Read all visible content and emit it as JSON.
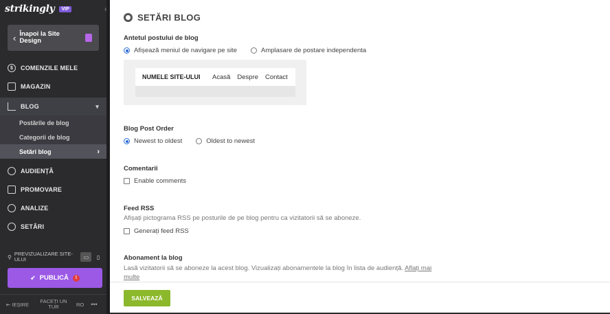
{
  "sidebar": {
    "logo": "strikingly",
    "vip_badge": "VIP",
    "back_button": "Înapoi la Site Design",
    "nav": {
      "orders": "COMENZILE MELE",
      "store": "MAGAZIN",
      "blog": "BLOG",
      "audience": "AUDIENȚĂ",
      "promotion": "PROMOVARE",
      "analytics": "ANALIZE",
      "settings": "SETĂRI"
    },
    "blog_sub": {
      "posts": "Postările de blog",
      "categories": "Categorii de blog",
      "settings": "Setări blog"
    },
    "preview_label": "PREVIZUALIZARE SITE-ULUI",
    "publish": "PUBLICĂ",
    "publish_alert": "!",
    "footer": {
      "exit": "IEȘIRE",
      "tour": "FACEȚI UN TUR",
      "lang": "RO",
      "more": "•••"
    }
  },
  "main": {
    "title": "SETĂRI BLOG",
    "header_section": {
      "label": "Antetul postului de blog",
      "option_nav": "Afișează meniul de navigare pe site",
      "option_standalone": "Amplasare de postare independenta"
    },
    "preview": {
      "site_name": "NUMELE SITE-ULUI",
      "links": [
        "Acasă",
        "Despre",
        "Contact"
      ]
    },
    "order_section": {
      "label": "Blog Post Order",
      "newest": "Newest to oldest",
      "oldest": "Oldest to newest"
    },
    "comments_section": {
      "label": "Comentarii",
      "enable": "Enable comments"
    },
    "rss_section": {
      "label": "Feed RSS",
      "description": "Afișați pictograma RSS pe posturile de pe blog pentru ca vizitatorii să se aboneze.",
      "generate": "Generați feed RSS"
    },
    "subscription_section": {
      "label": "Abonament la blog",
      "description": "Lasă vizitatorii să se aboneze la acest blog. Vizualizați abonamentele la blog în lista de audiență.",
      "learn_more": "Aflați mai multe"
    },
    "save_button": "SALVEAZĂ"
  }
}
